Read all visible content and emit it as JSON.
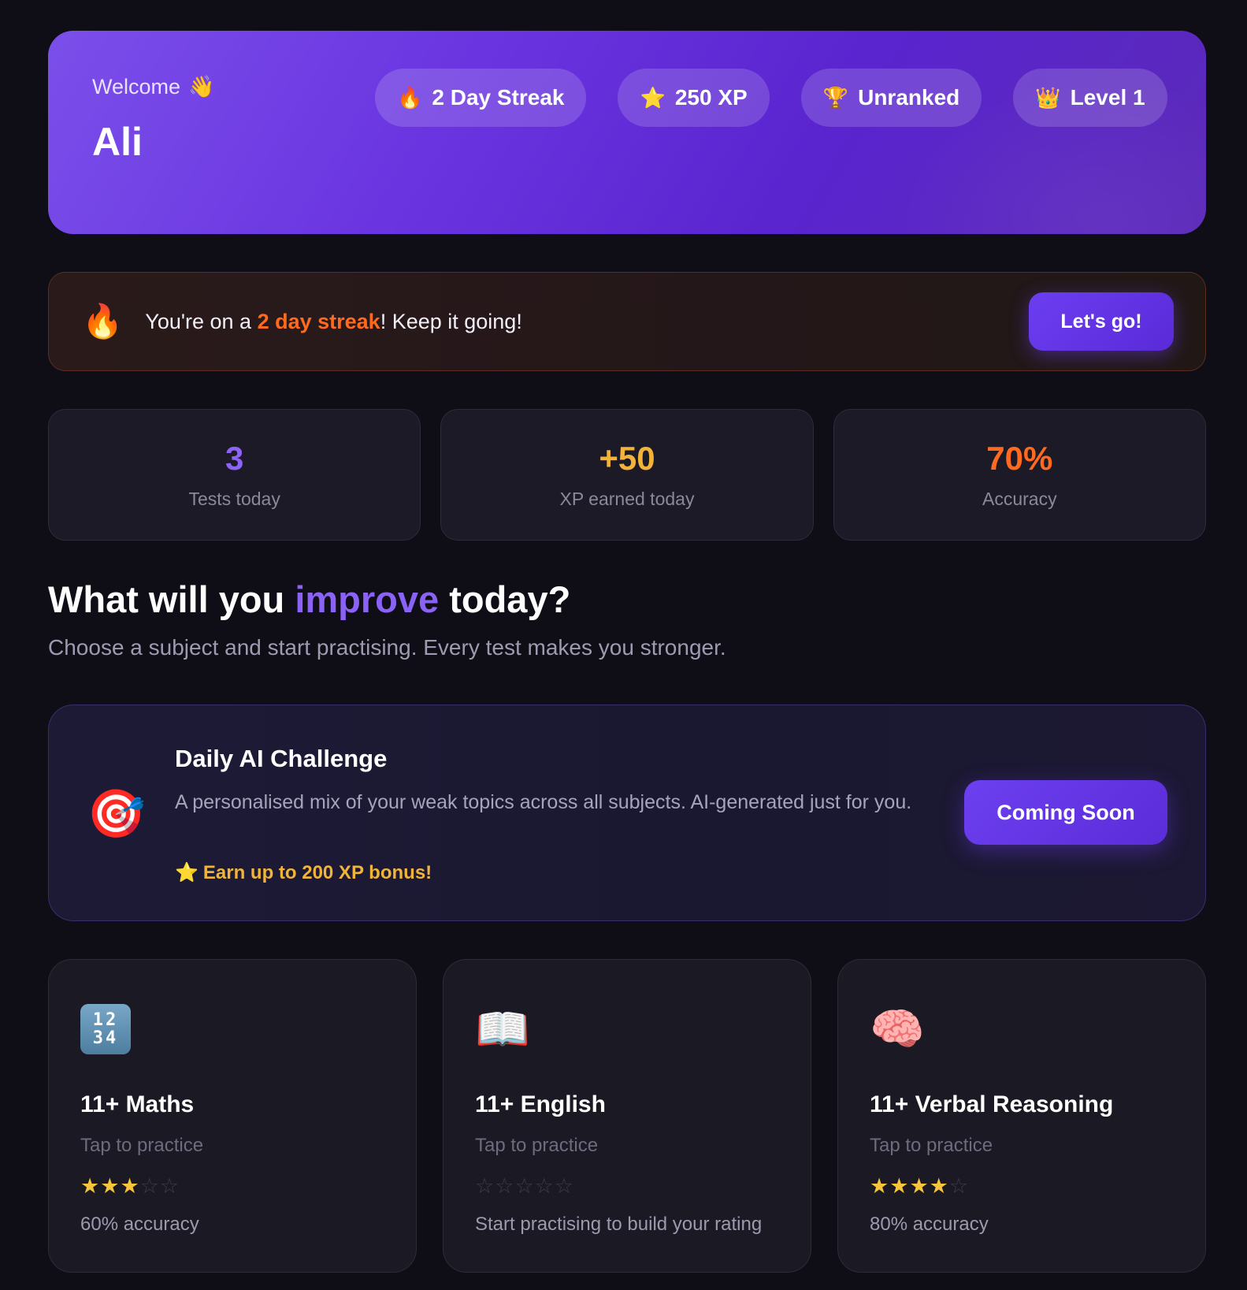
{
  "hero": {
    "welcome": "Welcome",
    "welcome_icon": "👋",
    "name": "Ali",
    "pills": [
      {
        "icon": "🔥",
        "icon_name": "fire-icon",
        "label": "2 Day Streak"
      },
      {
        "icon": "⭐",
        "icon_name": "star-icon",
        "label": "250 XP"
      },
      {
        "icon": "🏆",
        "icon_name": "trophy-icon",
        "label": "Unranked"
      },
      {
        "icon": "👑",
        "icon_name": "crown-icon",
        "label": "Level 1"
      }
    ]
  },
  "streak_banner": {
    "icon": "🔥",
    "prefix": "You're on a ",
    "highlight": "2 day streak",
    "suffix": "! Keep it going!",
    "button": "Let's go!"
  },
  "stats": [
    {
      "value": "3",
      "label": "Tests today",
      "color": "#8c63f6"
    },
    {
      "value": "+50",
      "label": "XP earned today",
      "color": "#f2b33a"
    },
    {
      "value": "70%",
      "label": "Accuracy",
      "color": "#ff6a1f"
    }
  ],
  "heading": {
    "before": "What will you ",
    "accent": "improve",
    "after": " today?",
    "subtitle": "Choose a subject and start practising. Every test makes you stronger."
  },
  "challenge": {
    "icon": "🎯",
    "title": "Daily AI Challenge",
    "description": "A personalised mix of your weak topics across all subjects. AI-generated just for you.",
    "bonus_icon": "⭐",
    "bonus": "Earn up to 200 XP bonus!",
    "button": "Coming Soon"
  },
  "subjects": [
    {
      "icon_name": "numbers-icon",
      "title": "11+ Maths",
      "subtitle": "Tap to practice",
      "rating": 3,
      "max_rating": 5,
      "footer": "60% accuracy"
    },
    {
      "icon_name": "book-icon",
      "icon": "📖",
      "title": "11+ English",
      "subtitle": "Tap to practice",
      "rating": 0,
      "max_rating": 5,
      "footer": "Start practising to build your rating"
    },
    {
      "icon_name": "brain-icon",
      "icon": "🧠",
      "title": "11+ Verbal Reasoning",
      "subtitle": "Tap to practice",
      "rating": 4,
      "max_rating": 5,
      "footer": "80% accuracy"
    }
  ],
  "maths_icon_digits": [
    "12",
    "34"
  ]
}
